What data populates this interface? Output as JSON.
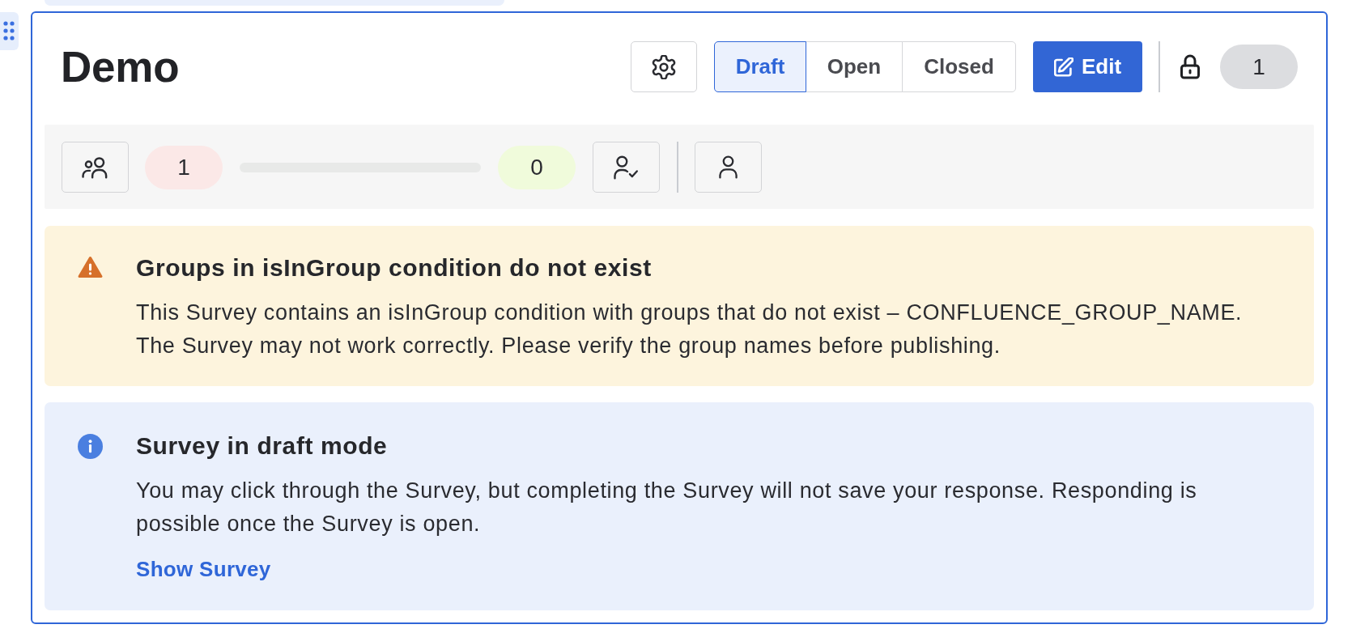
{
  "survey": {
    "title": "Demo"
  },
  "header": {
    "status_tabs": [
      {
        "label": "Draft",
        "selected": true
      },
      {
        "label": "Open",
        "selected": false
      },
      {
        "label": "Closed",
        "selected": false
      }
    ],
    "edit_button": {
      "label": "Edit"
    },
    "count": "1"
  },
  "stats": {
    "start_count": "1",
    "progress": {
      "level": 0
    },
    "end_count": "0"
  },
  "alerts": [
    {
      "kind": "warning",
      "title": "Groups in isInGroup condition do not exist",
      "text": "This Survey contains an isInGroup condition with groups that do not exist – CONFLUENCE_GROUP_NAME. The Survey may not work correctly. Please verify the group names before publishing."
    },
    {
      "kind": "info",
      "title": "Survey in draft mode",
      "text": "You may click through the Survey, but completing the Survey will not save your response. Responding is possible once the Survey is open.",
      "link": "Show Survey"
    }
  ]
}
